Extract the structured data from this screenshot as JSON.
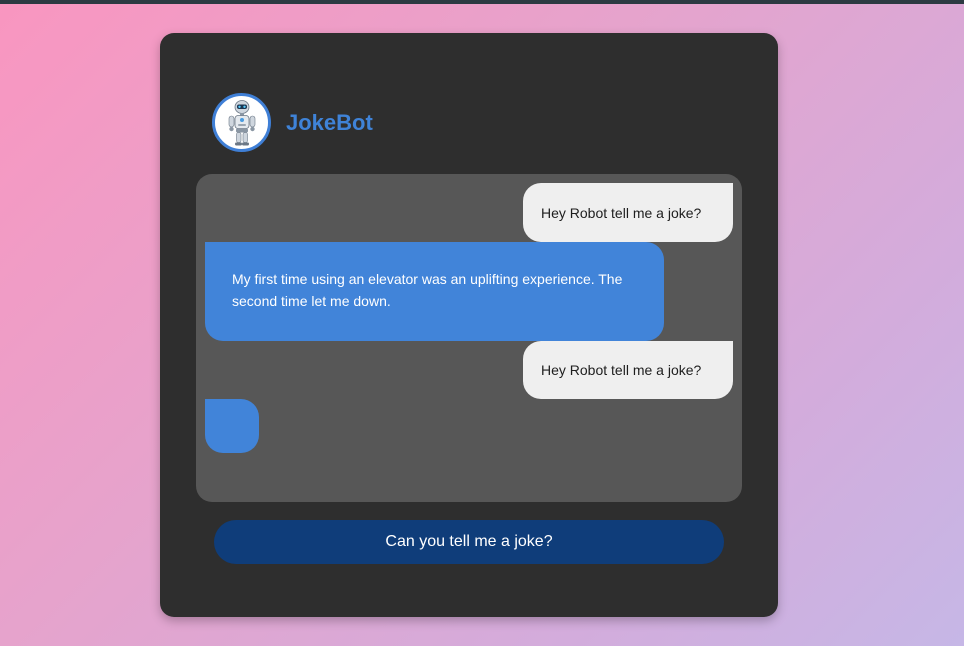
{
  "app": {
    "bot_name": "JokeBot",
    "avatar_icon": "robot-icon"
  },
  "messages": [
    {
      "sender": "user",
      "text": "Hey Robot tell me a joke?"
    },
    {
      "sender": "bot",
      "text": "My first time using an elevator was an uplifting experience. The second time let me down."
    },
    {
      "sender": "user",
      "text": "Hey Robot tell me a joke?"
    },
    {
      "sender": "bot",
      "text": ""
    }
  ],
  "actions": {
    "ask_button_label": "Can you tell me a joke?"
  },
  "colors": {
    "accent": "#4184d9",
    "button": "#0f3d7a",
    "card": "#2e2e2e",
    "chat_area": "#575757",
    "user_bubble": "#efefef"
  }
}
